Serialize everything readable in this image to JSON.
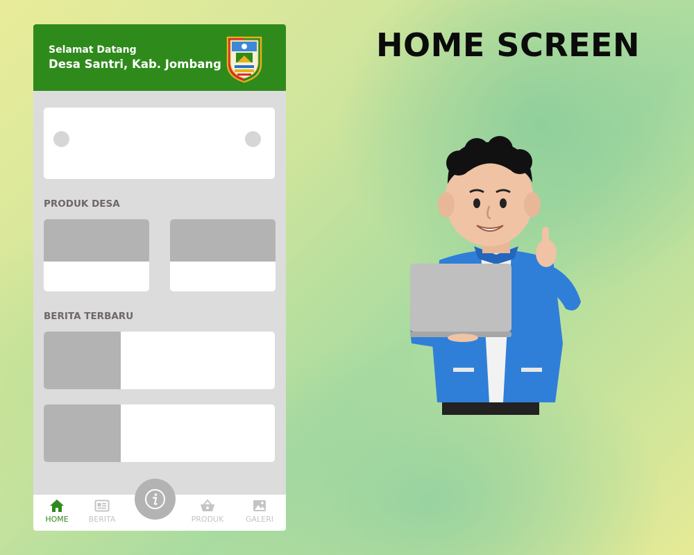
{
  "page": {
    "title": "HOME SCREEN"
  },
  "header": {
    "greeting": "Selamat Datang",
    "village": "Desa Santri, Kab. Jombang",
    "crest_icon": "regency-crest-icon"
  },
  "sections": {
    "products_title": "PRODUK DESA",
    "news_title": "BERITA TERBARU"
  },
  "bottom_nav": {
    "items": [
      {
        "label": "HOME",
        "icon": "home-icon",
        "active": true
      },
      {
        "label": "BERITA",
        "icon": "newspaper-icon",
        "active": false
      },
      {
        "label": "PRODUK",
        "icon": "basket-icon",
        "active": false
      },
      {
        "label": "GALERI",
        "icon": "image-icon",
        "active": false
      }
    ],
    "center_button_icon": "info-icon"
  },
  "colors": {
    "brand_green": "#2f8a1c",
    "placeholder_gray": "#b3b3b3",
    "screen_bg": "#dcdcdc",
    "inactive_nav": "#c4c4c4"
  }
}
